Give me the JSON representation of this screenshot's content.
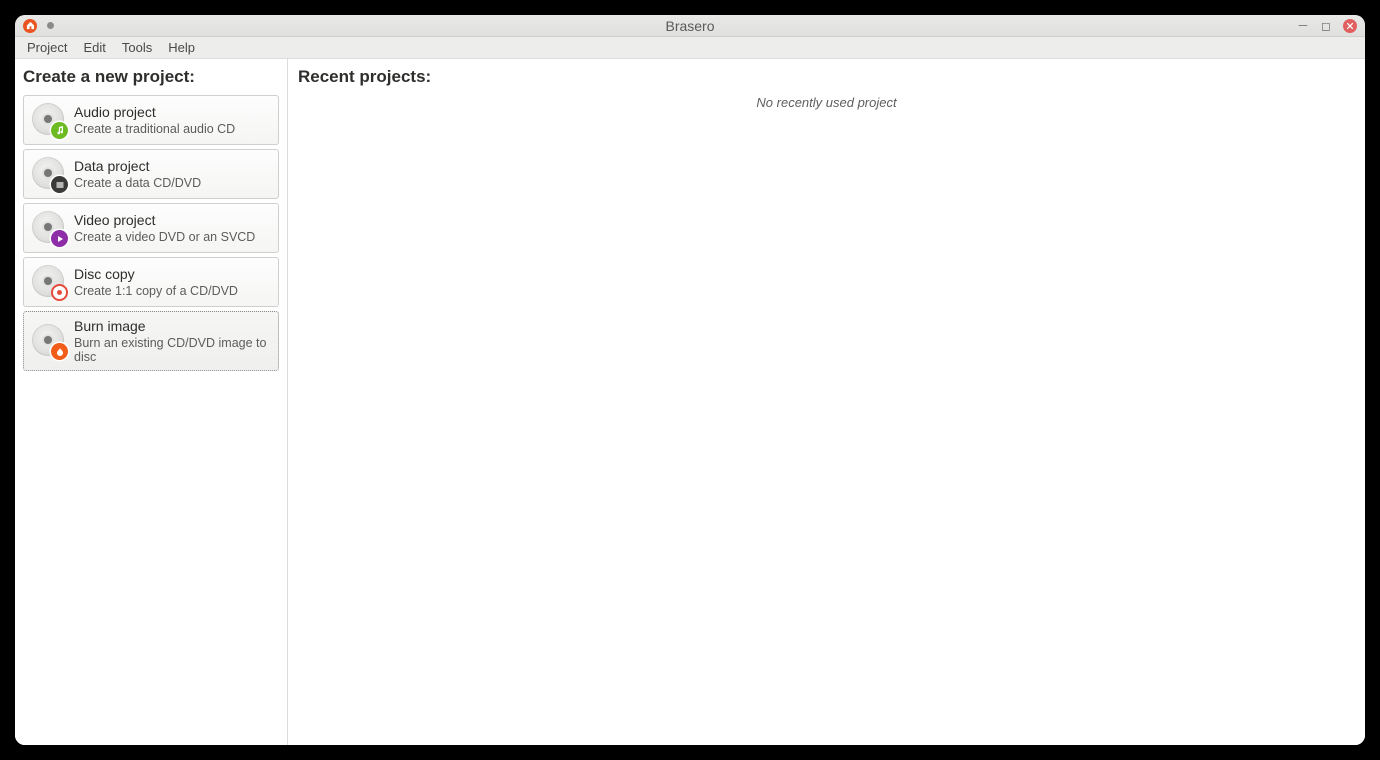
{
  "window": {
    "title": "Brasero"
  },
  "menubar": {
    "items": [
      "Project",
      "Edit",
      "Tools",
      "Help"
    ]
  },
  "left": {
    "header": "Create a new project:",
    "projects": [
      {
        "title": "Audio project",
        "desc": "Create a traditional audio CD",
        "icon": "audio"
      },
      {
        "title": "Data project",
        "desc": "Create a data CD/DVD",
        "icon": "data"
      },
      {
        "title": "Video project",
        "desc": "Create a video DVD or an SVCD",
        "icon": "video"
      },
      {
        "title": "Disc copy",
        "desc": "Create 1:1 copy of a CD/DVD",
        "icon": "copy"
      },
      {
        "title": "Burn image",
        "desc": "Burn an existing CD/DVD image to disc",
        "icon": "burn"
      }
    ]
  },
  "right": {
    "header": "Recent projects:",
    "empty_text": "No recently used project"
  }
}
